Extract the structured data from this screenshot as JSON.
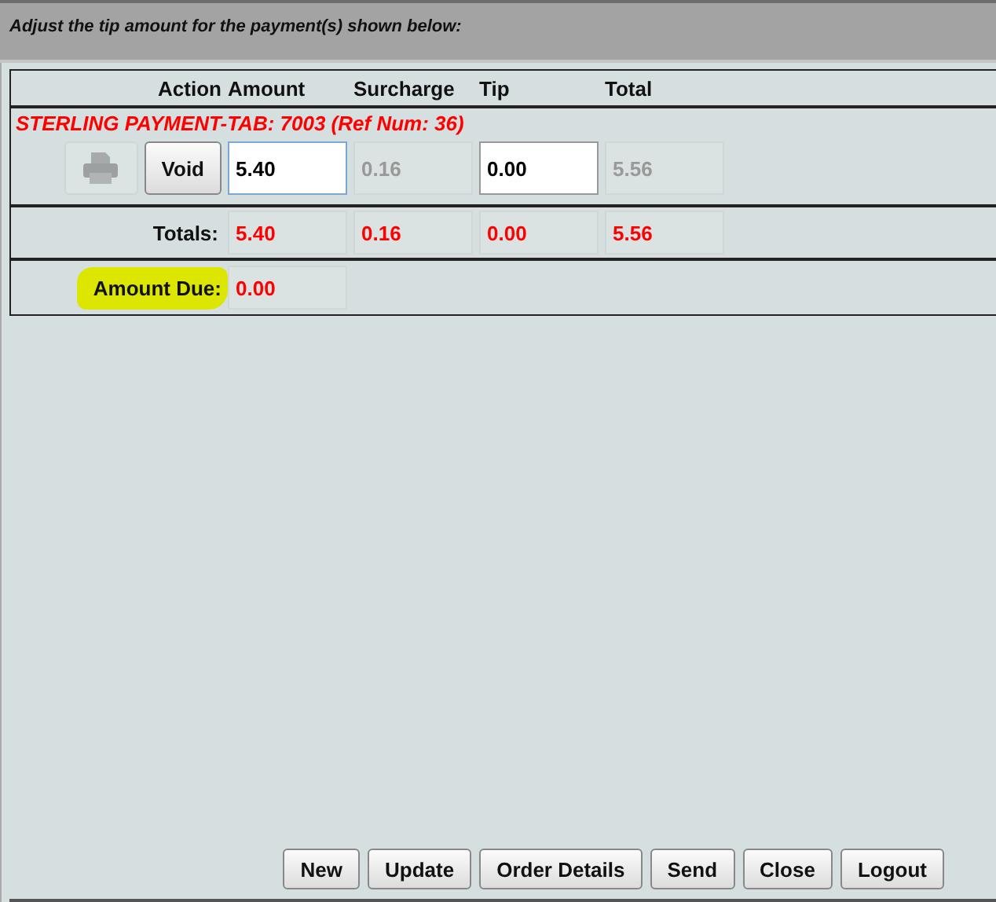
{
  "instruction": "Adjust the tip amount for the payment(s) shown below:",
  "columns": [
    "Action",
    "Amount",
    "Surcharge",
    "Tip",
    "Total"
  ],
  "payment": {
    "title": "STERLING PAYMENT-TAB: 7003 (Ref Num: 36)",
    "print_disabled": true,
    "void_label": "Void",
    "cells": [
      {
        "kind": "input",
        "value": "5.40",
        "focused": true
      },
      {
        "kind": "readonly",
        "value": "0.16"
      },
      {
        "kind": "input",
        "value": "0.00",
        "focused": false
      },
      {
        "kind": "readonly",
        "value": "5.56"
      }
    ]
  },
  "totals": {
    "label": "Totals:",
    "values": [
      "5.40",
      "0.16",
      "0.00",
      "5.56"
    ]
  },
  "amount_due": {
    "label": "Amount Due:",
    "value": "0.00",
    "highlighted": true
  },
  "buttons": [
    "New",
    "Update",
    "Order Details",
    "Send",
    "Close",
    "Logout"
  ]
}
